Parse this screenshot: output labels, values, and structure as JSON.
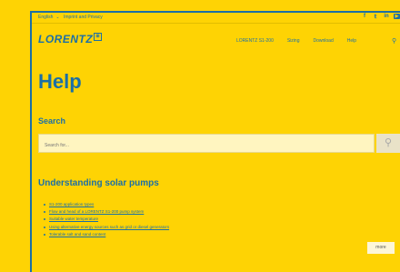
{
  "topbar": {
    "language": "English",
    "imprint": "Imprint and Privacy",
    "social_icons": [
      "facebook-icon",
      "twitter-icon",
      "linkedin-icon",
      "youtube-icon"
    ]
  },
  "logo": {
    "text": "LORENTZ",
    "mark": "⊞"
  },
  "nav": {
    "items": [
      "LORENTZ S1-200",
      "Sizing",
      "Download",
      "Help"
    ],
    "search_icon": "search-icon"
  },
  "page_title": "Help",
  "search": {
    "heading": "Search",
    "placeholder": "Search for..."
  },
  "section": {
    "heading": "Understanding solar pumps",
    "links": [
      "S1-200 application types",
      "Flow and head of a LORENTZ S1-200 pump system",
      "Suitable water temperature",
      "Using alternative energy sources such as grid or diesel generators",
      "Tolerable salt and sand content"
    ]
  },
  "more_button": "more",
  "colors": {
    "background": "#fed304",
    "accent": "#1b6fa6"
  }
}
